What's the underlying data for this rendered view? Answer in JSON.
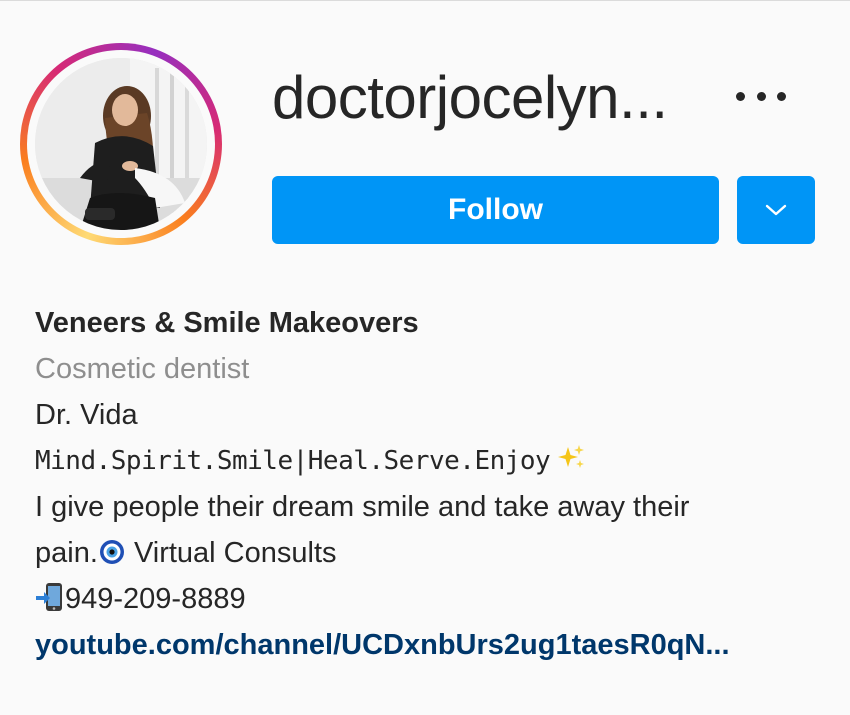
{
  "profile": {
    "username": "doctorjocelyn...",
    "follow_label": "Follow",
    "avatar_icon": "profile-photo"
  },
  "bio": {
    "name": "Veneers & Smile Makeovers",
    "category": "Cosmetic dentist",
    "line1": "Dr. Vida",
    "line2": "Mind.Spirit.Smile|Heal.Serve.Enjoy",
    "line3": "I give people their dream smile and take away their",
    "line4_text": "pain.",
    "line4_after": " Virtual Consults",
    "phone": "949-209-8889",
    "link": "youtube.com/channel/UCDxnbUrs2ug1taesR0qN..."
  },
  "colors": {
    "follow_button": "#0095f6",
    "link": "#00376b",
    "category": "#8e8e8e"
  },
  "icons": {
    "more": "more-horizontal-icon",
    "dropdown": "chevron-down-icon",
    "sparkle": "sparkles-icon",
    "evil_eye": "nazar-amulet-icon",
    "phone": "mobile-phone-arrow-icon"
  }
}
